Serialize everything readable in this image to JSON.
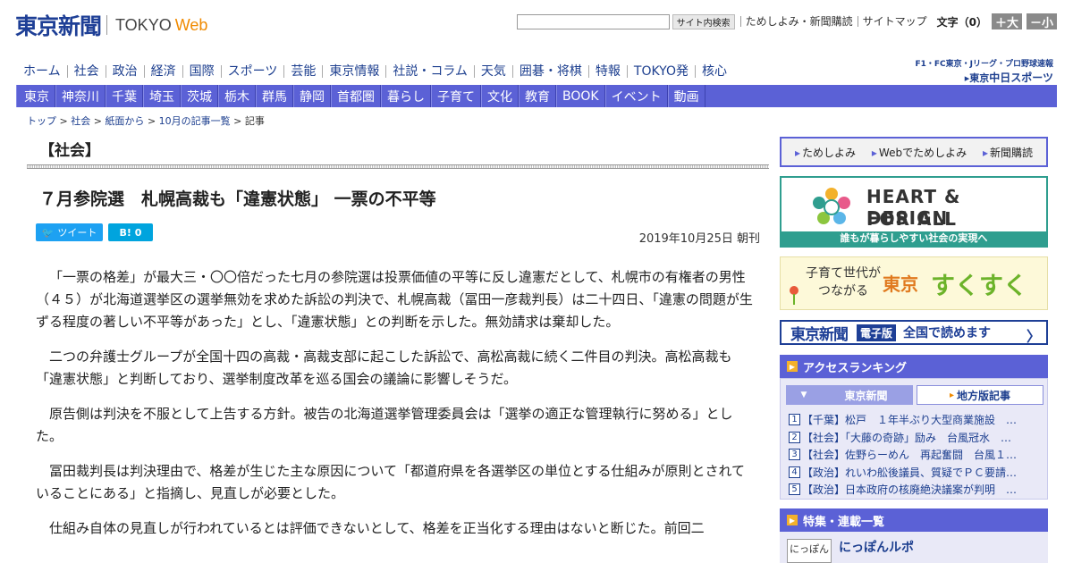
{
  "header": {
    "logo_jp": "東京新聞",
    "logo_en_main": "TOKYO",
    "logo_en_web": "Web",
    "search_button": "サイト内検索",
    "links": [
      "ためしよみ・新聞購読",
      "サイトマップ"
    ],
    "fontsize_label": "文字（0）",
    "font_plus": "＋大",
    "font_minus": "－小"
  },
  "nav_main": [
    "ホーム",
    "社会",
    "政治",
    "経済",
    "国際",
    "スポーツ",
    "芸能",
    "東京情報",
    "社説・コラム",
    "天気",
    "囲碁・将棋",
    "特報",
    "TOKYO発",
    "核心"
  ],
  "chunichi": {
    "top": "F1・FC東京・Jリーグ・プロ野球速報",
    "bottom_prefix": "▸東京",
    "bottom_name": "中日スポーツ"
  },
  "nav_region": [
    "東京",
    "神奈川",
    "千葉",
    "埼玉",
    "茨城",
    "栃木",
    "群馬",
    "静岡",
    "首都圏",
    "暮らし",
    "子育て",
    "文化",
    "教育",
    "BOOK",
    "イベント",
    "動画"
  ],
  "breadcrumb": {
    "items": [
      "トップ",
      "社会",
      "紙面から",
      "10月の記事一覧"
    ],
    "current": "記事",
    "sep": ">"
  },
  "article": {
    "section": "【社会】",
    "headline": "７月参院選　札幌高裁も「違憲状態」 一票の不平等",
    "tweet": "ツイート",
    "hatena": "B!  0",
    "date": "2019年10月25日 朝刊",
    "paragraphs": [
      "「一票の格差」が最大三・〇〇倍だった七月の参院選は投票価値の平等に反し違憲だとして、札幌市の有権者の男性（４５）が北海道選挙区の選挙無効を求めた訴訟の判決で、札幌高裁（冨田一彦裁判長）は二十四日、「違憲の問題が生ずる程度の著しい不平等があった」とし、「違憲状態」との判断を示した。無効請求は棄却した。",
      "二つの弁護士グループが全国十四の高裁・高裁支部に起こした訴訟で、高松高裁に続く二件目の判決。高松高裁も「違憲状態」と判断しており、選挙制度改革を巡る国会の議論に影響しそうだ。",
      "原告側は判決を不服として上告する方針。被告の北海道選挙管理委員会は「選挙の適正な管理執行に努める」とした。",
      "冨田裁判長は判決理由で、格差が生じた主な原因について「都道府県を各選挙区の単位とする仕組みが原則とされていることにある」と指摘し、見直しが必要とした。",
      "仕組み自体の見直しが行われているとは評価できないとして、格差を正当化する理由はないと断じた。前回二"
    ]
  },
  "sidebar": {
    "tameshi": [
      "ためしよみ",
      "Webでためしよみ",
      "新聞購読"
    ],
    "heart": {
      "line1": "HEART & DESIGN",
      "line2": "FOR ALL",
      "strip": "誰もが暮らしやすい社会の実現へ"
    },
    "sukusuku": {
      "small1": "子育て世代が",
      "small2": "つながる",
      "big1": "東京",
      "big2": "すくすく"
    },
    "denshi": {
      "name": "東京新聞",
      "tag": "電子版",
      "msg": "全国で読めます",
      "arrow": "〉"
    },
    "ranking": {
      "title": "アクセスランキング",
      "tab_on": "東京新聞",
      "tab_off": "地方版記事",
      "items": [
        {
          "n": "1",
          "text": "【千葉】松戸　１年半ぶり大型商業施設　…"
        },
        {
          "n": "2",
          "text": "【社会】「大藤の奇跡」励み　台風冠水　…"
        },
        {
          "n": "3",
          "text": "【社会】佐野らーめん　再起奮闘　台風１…"
        },
        {
          "n": "4",
          "text": "【政治】れいわ舩後議員、質疑でＰＣ要請…"
        },
        {
          "n": "5",
          "text": "【政治】日本政府の核廃絶決議案が判明　…"
        }
      ]
    },
    "feature": {
      "title": "特集・連載一覧",
      "thumb": "にっぽん",
      "item": "にっぽんルポ"
    }
  },
  "colors": {
    "brand_blue": "#1e3f96",
    "nav_purple": "#5b61d6",
    "accent_orange": "#f08a00",
    "heart_teal": "#2f9e8f"
  }
}
